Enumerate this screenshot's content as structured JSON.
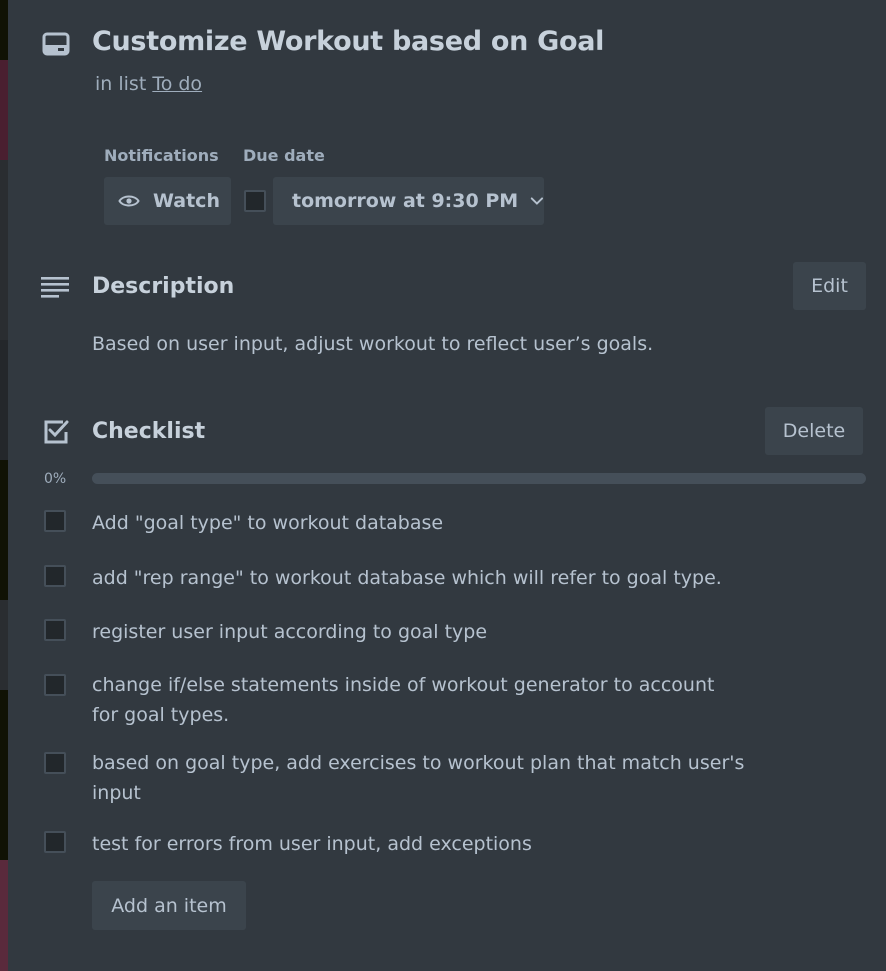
{
  "card": {
    "title": "Customize Workout based on Goal",
    "in_list_prefix": "in list",
    "list_name": "To do"
  },
  "notifications": {
    "label": "Notifications",
    "watch_label": "Watch"
  },
  "due_date": {
    "label": "Due date",
    "value": "tomorrow at 9:30 PM",
    "completed": false
  },
  "description": {
    "title": "Description",
    "edit_label": "Edit",
    "text": "Based on user input, adjust workout to reflect user’s goals."
  },
  "checklist": {
    "title": "Checklist",
    "delete_label": "Delete",
    "progress_text": "0%",
    "progress_value": 0,
    "items": [
      {
        "text": "Add \"goal type\" to workout database",
        "checked": false
      },
      {
        "text": "add \"rep range\" to workout database which will refer to goal type.",
        "checked": false
      },
      {
        "text": "register user input according to goal type",
        "checked": false
      },
      {
        "text": "change if/else statements inside of workout generator to account for goal types.",
        "checked": false
      },
      {
        "text": "based on goal type, add exercises to workout plan that match user's input",
        "checked": false
      },
      {
        "text": "test for errors from user input, add exceptions",
        "checked": false
      }
    ],
    "add_item_label": "Add an item"
  },
  "colors": {
    "modal_bg": "#323940",
    "button_bg": "#3b444c",
    "text": "#b6c2cf",
    "heading": "#c7d1db",
    "backdrop_accent": "#8a2a4a"
  },
  "icons": [
    "card-icon",
    "eye-icon",
    "chevron-down-icon",
    "description-icon",
    "checklist-icon"
  ]
}
